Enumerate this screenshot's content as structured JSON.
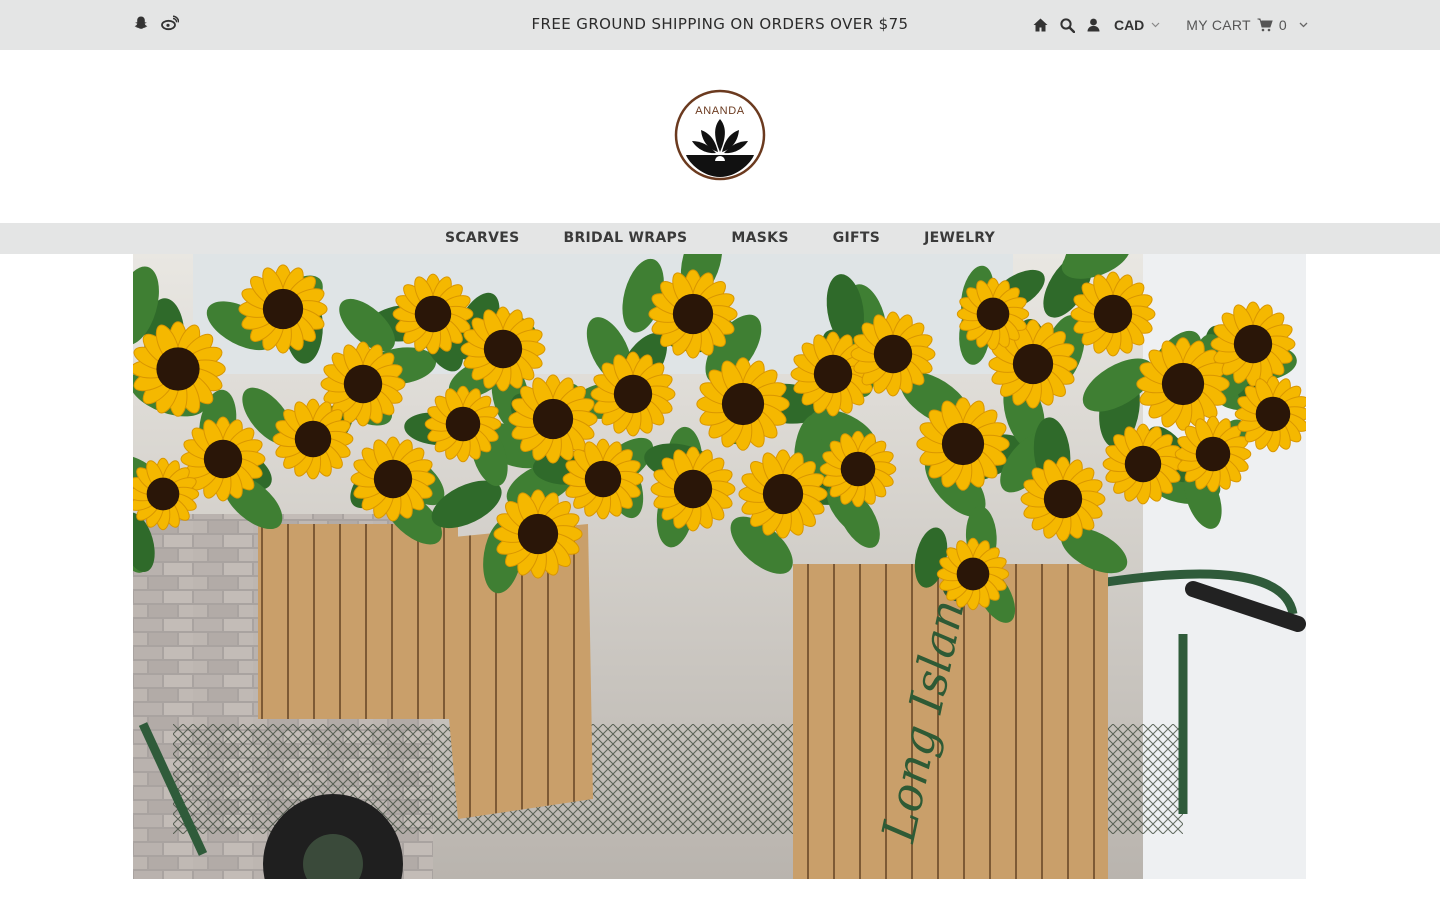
{
  "topbar": {
    "announcement": "FREE GROUND SHIPPING ON ORDERS OVER $75",
    "social_icons": [
      "snapchat-icon",
      "weibo-icon"
    ],
    "currency": "CAD",
    "cart_label": "MY CART",
    "cart_count": "0"
  },
  "logo": {
    "text": "ANANDA"
  },
  "nav": {
    "items": [
      {
        "label": "SCARVES"
      },
      {
        "label": "BRIDAL WRAPS"
      },
      {
        "label": "MASKS"
      },
      {
        "label": "GIFTS"
      },
      {
        "label": "JEWELRY"
      }
    ]
  },
  "colors": {
    "bar_bg": "#e4e5e5",
    "logo_ring": "#6b3a1f",
    "sunflower": "#f5b800"
  },
  "hero": {
    "subject": "sunflowers in wooden crates on a cart"
  }
}
